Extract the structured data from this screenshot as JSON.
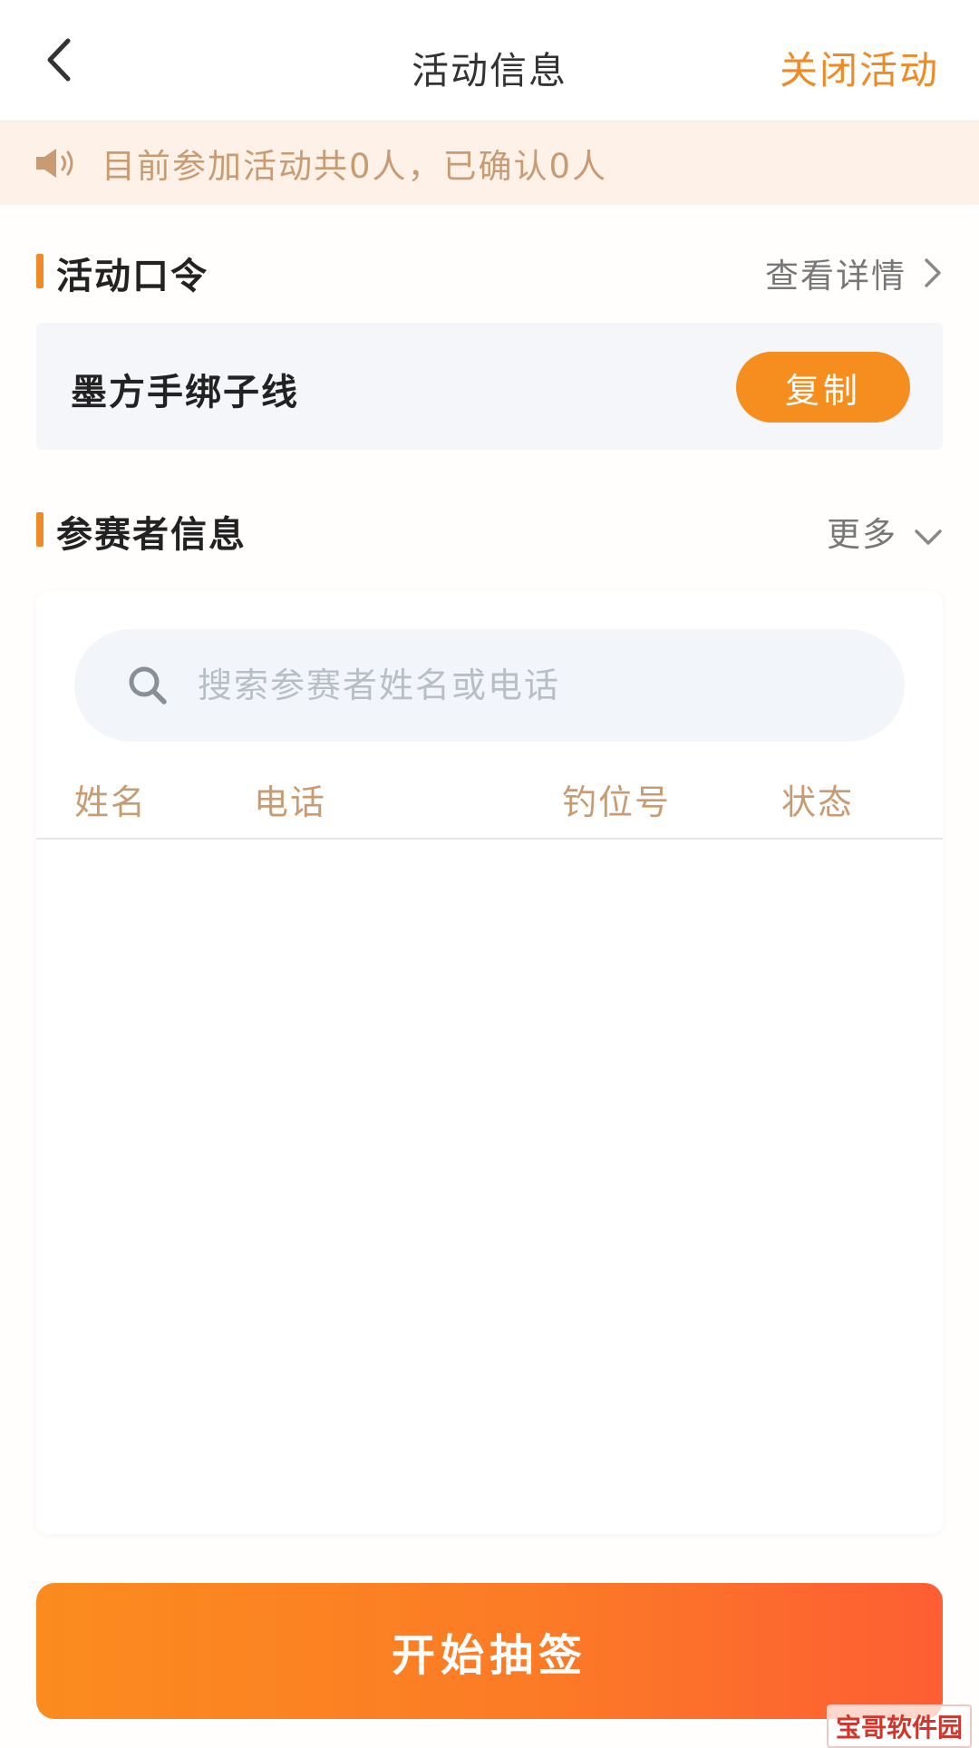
{
  "header": {
    "title": "活动信息",
    "close_label": "关闭活动"
  },
  "notice": {
    "text": "目前参加活动共0人，已确认0人"
  },
  "activity_code_section": {
    "title": "活动口令",
    "link_label": "查看详情",
    "code": "墨方手绑子线",
    "copy_label": "复制"
  },
  "participant_section": {
    "title": "参赛者信息",
    "more_label": "更多",
    "search_placeholder": "搜索参赛者姓名或电话",
    "search_value": "",
    "columns": [
      "姓名",
      "电话",
      "钓位号",
      "状态"
    ],
    "rows": []
  },
  "footer": {
    "start_label": "开始抽签"
  },
  "watermark": {
    "text": "宝哥软件园"
  },
  "colors": {
    "accent": "#f08a24",
    "notice_bg": "#fdf1e8",
    "notice_text": "#c99b73",
    "button_gradient_start": "#fb8b1e",
    "button_gradient_end": "#fd5e33"
  },
  "icons": {
    "back": "chevron-left-icon",
    "speaker": "speaker-icon",
    "details_arrow": "chevron-right-icon",
    "more_arrow": "chevron-down-icon",
    "search": "search-icon"
  }
}
